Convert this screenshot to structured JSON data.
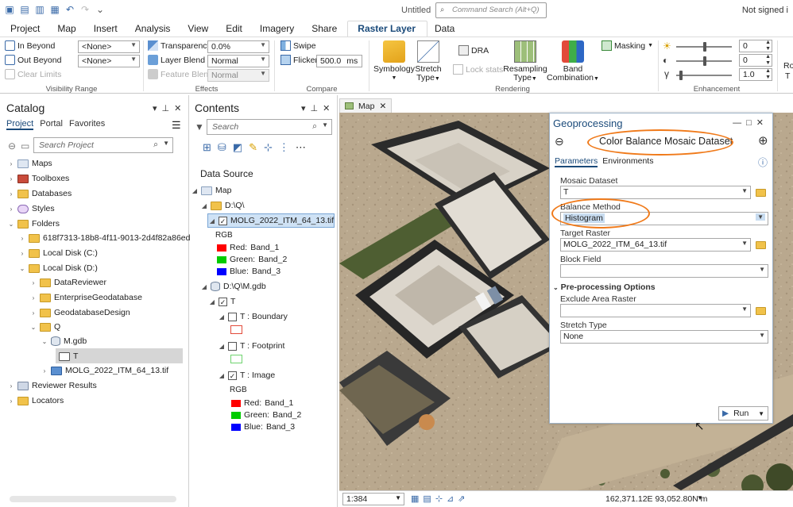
{
  "titlebar": {
    "doc_title": "Untitled",
    "search_placeholder": "Command Search (Alt+Q)",
    "signin": "Not signed i"
  },
  "menu": [
    "Project",
    "Map",
    "Insert",
    "Analysis",
    "View",
    "Edit",
    "Imagery",
    "Share",
    "Raster Layer",
    "Data"
  ],
  "ribbon": {
    "visibility": {
      "in_beyond": "In Beyond",
      "out_beyond": "Out Beyond",
      "clear_limits": "Clear Limits",
      "in_value": "<None>",
      "out_value": "<None>",
      "label": "Visibility Range"
    },
    "effects": {
      "transparency": "Transparency",
      "transparency_value": "0.0%",
      "layer_blend": "Layer Blend",
      "layer_blend_value": "Normal",
      "feature_blend": "Feature Blend",
      "feature_blend_value": "Normal",
      "label": "Effects"
    },
    "compare": {
      "swipe": "Swipe",
      "flicker": "Flicker",
      "flicker_value": "500.0",
      "flicker_unit": "ms",
      "label": "Compare"
    },
    "rendering": {
      "symbology": "Symbology",
      "stretch": "Stretch",
      "stretch_type": "Type",
      "dra": "DRA",
      "lock_stats": "Lock stats",
      "resampling": "Resampling",
      "resampling_type": "Type",
      "band": "Band",
      "band_combination": "Combination",
      "masking": "Masking",
      "label": "Rendering"
    },
    "enhancement": {
      "brightness": "0",
      "contrast": "0",
      "gamma": "1.0",
      "label": "Enhancement"
    },
    "extra": {
      "ro": "Ro",
      "t": "T"
    }
  },
  "catalog": {
    "title": "Catalog",
    "tabs": [
      "Project",
      "Portal",
      "Favorites"
    ],
    "search_placeholder": "Search Project",
    "items": [
      {
        "label": "Maps"
      },
      {
        "label": "Toolboxes"
      },
      {
        "label": "Databases"
      },
      {
        "label": "Styles"
      },
      {
        "label": "Folders"
      },
      {
        "label": "618f7313-18b8-4f11-9013-2d4f82a86ed0"
      },
      {
        "label": "Local Disk (C:)"
      },
      {
        "label": "Local Disk (D:)"
      },
      {
        "label": "DataReviewer"
      },
      {
        "label": "EnterpriseGeodatabase"
      },
      {
        "label": "GeodatabaseDesign"
      },
      {
        "label": "Q"
      },
      {
        "label": "M.gdb"
      },
      {
        "label": "T"
      },
      {
        "label": "MOLG_2022_ITM_64_13.tif"
      },
      {
        "label": "Reviewer Results"
      },
      {
        "label": "Locators"
      }
    ]
  },
  "contents": {
    "title": "Contents",
    "search_placeholder": "Search",
    "data_source": "Data Source",
    "map": "Map",
    "folder1": "D:\\Q\\",
    "layer1": "MOLG_2022_ITM_64_13.tif",
    "rgb": "RGB",
    "bands1": [
      {
        "ch": "Red:",
        "band": "Band_1",
        "color": "#ff0000"
      },
      {
        "ch": "Green:",
        "band": "Band_2",
        "color": "#00cc00"
      },
      {
        "ch": "Blue:",
        "band": "Band_3",
        "color": "#0000ff"
      }
    ],
    "folder2": "D:\\Q\\M.gdb",
    "mosaic": "T",
    "boundary": "T : Boundary",
    "footprint": "T : Footprint",
    "image": "T : Image",
    "rgb2": "RGB",
    "bands2": [
      {
        "ch": "Red:",
        "band": "Band_1",
        "color": "#ff0000"
      },
      {
        "ch": "Green:",
        "band": "Band_2",
        "color": "#00cc00"
      },
      {
        "ch": "Blue:",
        "band": "Band_3",
        "color": "#0000ff"
      }
    ]
  },
  "map": {
    "tab": "Map",
    "scale": "1:384",
    "coords": "162,371.12E 93,052.80N m"
  },
  "geoprocessing": {
    "title": "Geoprocessing",
    "tool": "Color Balance Mosaic Dataset",
    "tabs": [
      "Parameters",
      "Environments"
    ],
    "mosaic_dataset_label": "Mosaic Dataset",
    "mosaic_dataset_value": "T",
    "balance_method_label": "Balance Method",
    "balance_method_value": "Histogram",
    "target_raster_label": "Target Raster",
    "target_raster_value": "MOLG_2022_ITM_64_13.tif",
    "block_field_label": "Block Field",
    "block_field_value": "",
    "preproc_label": "Pre-processing Options",
    "exclude_label": "Exclude Area Raster",
    "exclude_value": "",
    "stretch_label": "Stretch Type",
    "stretch_value": "None",
    "run": "Run",
    "annotation_color": "#f07a1a"
  }
}
